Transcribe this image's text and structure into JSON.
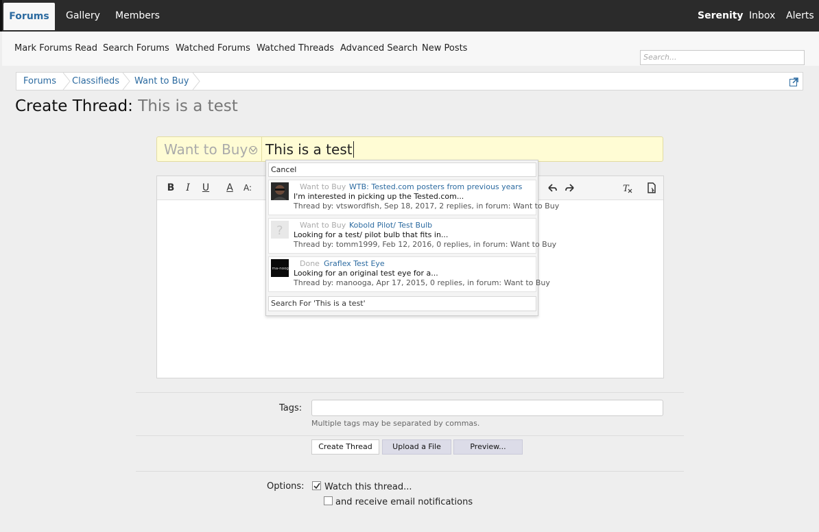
{
  "top_nav": {
    "tabs": [
      "Forums",
      "Gallery",
      "Members"
    ],
    "user": "Serenity",
    "inbox": "Inbox",
    "alerts": "Alerts"
  },
  "sub_nav": {
    "links": [
      "Mark Forums Read",
      "Search Forums",
      "Watched Forums",
      "Watched Threads",
      "Advanced Search",
      "New Posts"
    ],
    "search_placeholder": "Search..."
  },
  "breadcrumb": [
    "Forums",
    "Classifieds",
    "Want to Buy"
  ],
  "page_title": {
    "prefix": "Create Thread:",
    "subject": "This is a test"
  },
  "title_field": {
    "prefix_selected": "Want to Buy",
    "value": "This is a test"
  },
  "suggestions": {
    "cancel": "Cancel",
    "items": [
      {
        "prefix": "Want to Buy",
        "title": "WTB: Tested.com posters from previous years",
        "snippet": "I'm interested in picking up the Tested.com...",
        "meta": "Thread by: vtswordfish, Sep 18, 2017, 2 replies, in forum: Want to Buy"
      },
      {
        "prefix": "Want to Buy",
        "title": "Kobold Pilot/ Test Bulb",
        "snippet": "Looking for a test/ pilot bulb that fits in...",
        "meta": "Thread by: tomm1999, Feb 12, 2016, 0 replies, in forum: Want to Buy"
      },
      {
        "prefix": "Done",
        "title": "Graflex Test Eye",
        "snippet": "Looking for an original test eye for a...",
        "meta": "Thread by: manooga, Apr 17, 2015, 0 replies, in forum: Want to Buy",
        "avatar_text": "ma-nooga"
      }
    ],
    "search_for": "Search For 'This is a test'"
  },
  "toolbar": {
    "bold": "B",
    "italic": "I",
    "underline": "U",
    "font_color": "A",
    "font_size": "A:"
  },
  "form": {
    "tags_label": "Tags:",
    "tags_hint": "Multiple tags may be separated by commas.",
    "create_button": "Create Thread",
    "upload_button": "Upload a File",
    "preview_button": "Preview...",
    "options_label": "Options:",
    "watch_label": "Watch this thread...",
    "email_label": "and receive email notifications",
    "watch_checked": true,
    "email_checked": false
  },
  "colors": {
    "link": "#2b6aa0",
    "topbar": "#2b2b2b",
    "title_bg": "#fffcd4"
  }
}
